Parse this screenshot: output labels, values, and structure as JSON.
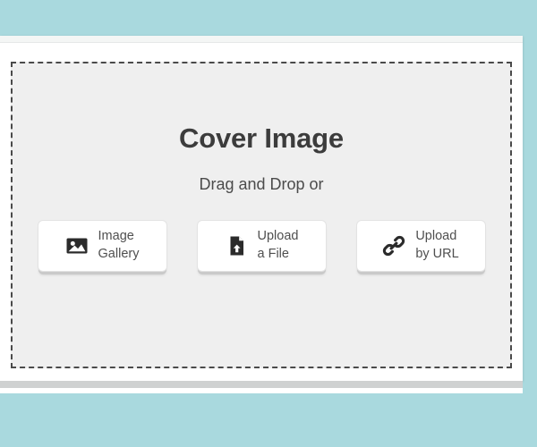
{
  "page": {
    "background_color": "#a9d9de"
  },
  "card": {
    "background_color": "#ffffff",
    "top_strip_color": "#f4f6f5",
    "bottom_bar_color": "#cfd1d1"
  },
  "dropzone": {
    "title": "Cover Image",
    "subtitle": "Drag and Drop or",
    "border_style": "dashed",
    "border_color": "#4a4a4a",
    "background_color": "#efefef",
    "actions": [
      {
        "id": "image-gallery",
        "icon": "image-gallery-icon",
        "label": "Image\nGallery"
      },
      {
        "id": "upload-a-file",
        "icon": "file-upload-icon",
        "label": "Upload\na File"
      },
      {
        "id": "upload-by-url",
        "icon": "link-icon",
        "label": "Upload\nby URL"
      }
    ]
  }
}
